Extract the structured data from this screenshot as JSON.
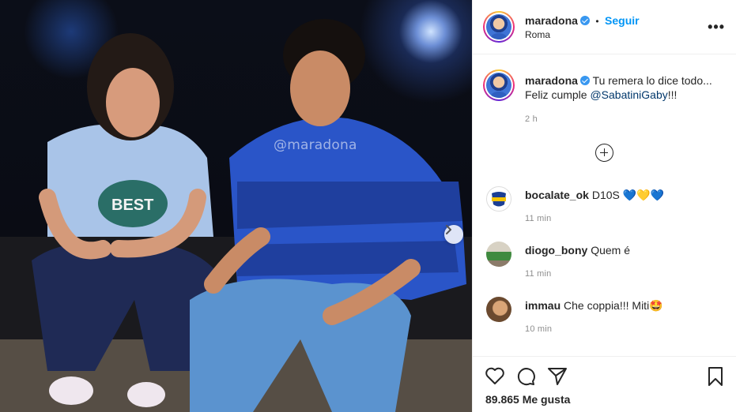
{
  "post": {
    "watermark": "@maradona"
  },
  "header": {
    "username": "maradona",
    "separator": "•",
    "follow_label": "Seguir",
    "location": "Roma",
    "more_label": "•••"
  },
  "caption": {
    "username": "maradona",
    "text_line1": "Tu remera lo dice todo...",
    "text_line2_prefix": "Feliz cumple ",
    "mention": "@SabatiniGaby",
    "text_line2_suffix": "!!!",
    "time": "2 h"
  },
  "comments": [
    {
      "username": "bocalate_ok",
      "text": "D10S ",
      "emoji": "💙💛💙",
      "time": "11 min"
    },
    {
      "username": "diogo_bony",
      "text": "Quem é",
      "emoji": "",
      "time": "11 min"
    },
    {
      "username": "immau",
      "text": "Che coppia!!! Miti",
      "emoji": "🤩",
      "time": "10 min"
    }
  ],
  "footer": {
    "likes": "89.865 Me gusta"
  },
  "colors": {
    "accent": "#0095f6",
    "verified": "#3897f0",
    "muted": "#8e8e8e"
  }
}
